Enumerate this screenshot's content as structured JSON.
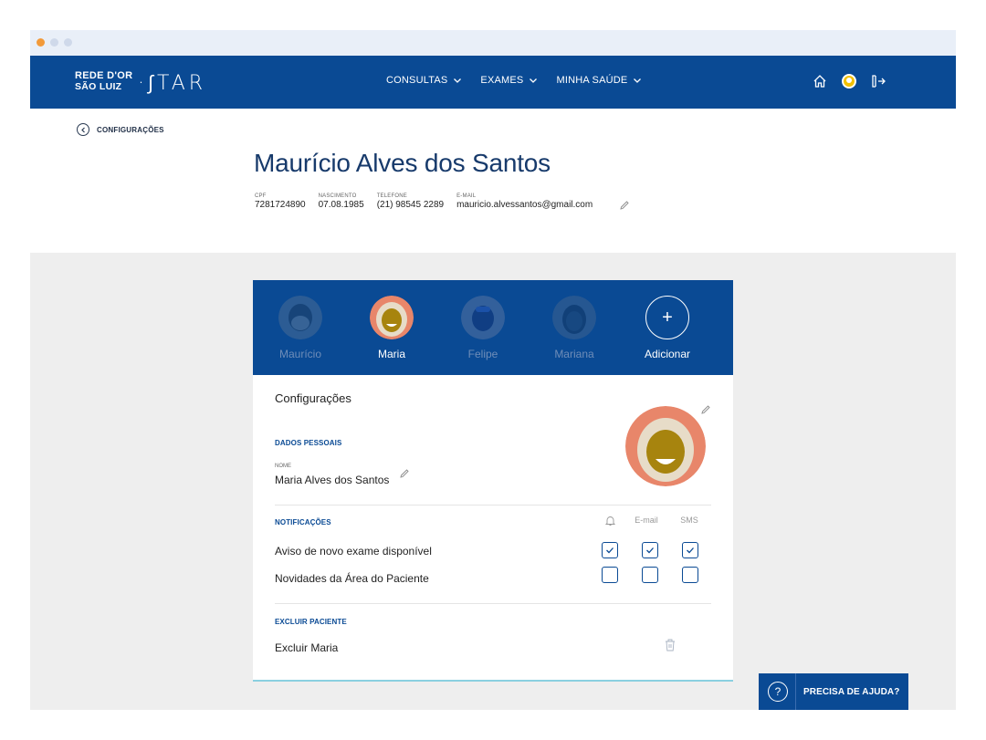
{
  "brand": {
    "rede_line1": "REDE D'OR",
    "rede_line2": "SÃO LUIZ",
    "star": "·∫TAR"
  },
  "nav": {
    "items": [
      {
        "label": "CONSULTAS"
      },
      {
        "label": "EXAMES"
      },
      {
        "label": "MINHA SAÚDE"
      }
    ],
    "icons": [
      "home-icon",
      "user-avatar-icon",
      "logout-icon"
    ]
  },
  "back": {
    "label": "CONFIGURAÇÕES"
  },
  "patient": {
    "name": "Maurício Alves dos Santos",
    "meta": [
      {
        "key": "CPF",
        "value": "7281724890"
      },
      {
        "key": "NASCIMENTO",
        "value": "07.08.1985"
      },
      {
        "key": "TELEFONE",
        "value": "(21) 98545 2289"
      },
      {
        "key": "E-MAIL",
        "value": "mauricio.alvessantos@gmail.com"
      }
    ]
  },
  "tabs": [
    {
      "label": "Maurício",
      "state": "dim"
    },
    {
      "label": "Maria",
      "state": "active"
    },
    {
      "label": "Felipe",
      "state": "dim"
    },
    {
      "label": "Mariana",
      "state": "dim"
    },
    {
      "label": "Adicionar",
      "state": "add",
      "icon": "+"
    }
  ],
  "settings": {
    "title": "Configurações",
    "personal": {
      "label": "DADOS PESSOAIS",
      "name_key": "NOME",
      "name_value": "Maria Alves dos Santos"
    },
    "notifications": {
      "label": "NOTIFICAÇÕES",
      "columns": [
        "E-mail",
        "SMS"
      ],
      "rows": [
        {
          "label": "Aviso de novo exame disponível",
          "checked": [
            true,
            true,
            true
          ]
        },
        {
          "label": "Novidades da Área do Paciente",
          "checked": [
            false,
            false,
            false
          ]
        }
      ]
    },
    "delete": {
      "label": "EXCLUIR PACIENTE",
      "action": "Excluir Maria"
    }
  },
  "help": {
    "q": "?",
    "label": "PRECISA DE AJUDA?"
  },
  "colors": {
    "primary": "#0a4a94",
    "title": "#173a6b",
    "accent": "#8ad0e0"
  }
}
